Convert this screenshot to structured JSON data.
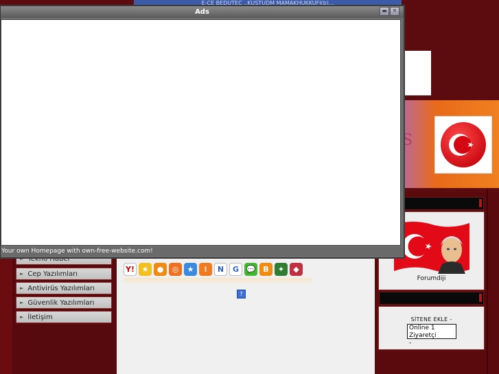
{
  "ads_window": {
    "title": "Ads",
    "footer_text": "Your own Homepage with own-free-website.com!",
    "controls": [
      "minimize",
      "close"
    ]
  },
  "top_banner_text": "E-CE  BEDUTEC  ..KUSTUDM  MAMAKHUKKUFI(b)...",
  "header_letter": "S",
  "left_nav": {
    "items": [
      {
        "label": "Tekno Haber"
      },
      {
        "label": "Cep Yazılımları"
      },
      {
        "label": "Antivirüs Yazılımları"
      },
      {
        "label": "Güvenlik Yazılımları"
      },
      {
        "label": "İletişim"
      }
    ]
  },
  "social_bookmarks": [
    {
      "name": "yahoo-icon",
      "glyph": "Y!",
      "color": "#ffffff",
      "text_color": "#cc0000"
    },
    {
      "name": "favorites-star-icon",
      "glyph": "★",
      "color": "#f4c020"
    },
    {
      "name": "orange-circle-icon",
      "glyph": "●",
      "color": "#f08a10"
    },
    {
      "name": "target-icon",
      "glyph": "◎",
      "color": "#f07020"
    },
    {
      "name": "blue-star-icon",
      "glyph": "★",
      "color": "#3a8ae0"
    },
    {
      "name": "dots-grid-icon",
      "glyph": "⁞",
      "color": "#f07a20"
    },
    {
      "name": "n-logo-icon",
      "glyph": "N",
      "color": "#ffffff",
      "text_color": "#2a60c0"
    },
    {
      "name": "google-icon",
      "glyph": "G",
      "color": "#ffffff",
      "text_color": "#3366cc"
    },
    {
      "name": "chat-bubble-icon",
      "glyph": "💬",
      "color": "#40b830"
    },
    {
      "name": "blogger-icon",
      "glyph": "B",
      "color": "#f08a10"
    },
    {
      "name": "multi-color-icon",
      "glyph": "✦",
      "color": "#2e7d32"
    },
    {
      "name": "diamond-icon",
      "glyph": "◆",
      "color": "#c03040"
    }
  ],
  "help_icon_glyph": "?",
  "right_panel": {
    "forum_label": "Forumdiji",
    "site_add_label": "SİTENE EKLE -",
    "online_text": "Online 1 Ziyaretçi",
    "online_sub": "-"
  },
  "colors": {
    "background": "#5c0b0e",
    "accent_orange": "#f08020",
    "flag_red": "#e30a17"
  }
}
